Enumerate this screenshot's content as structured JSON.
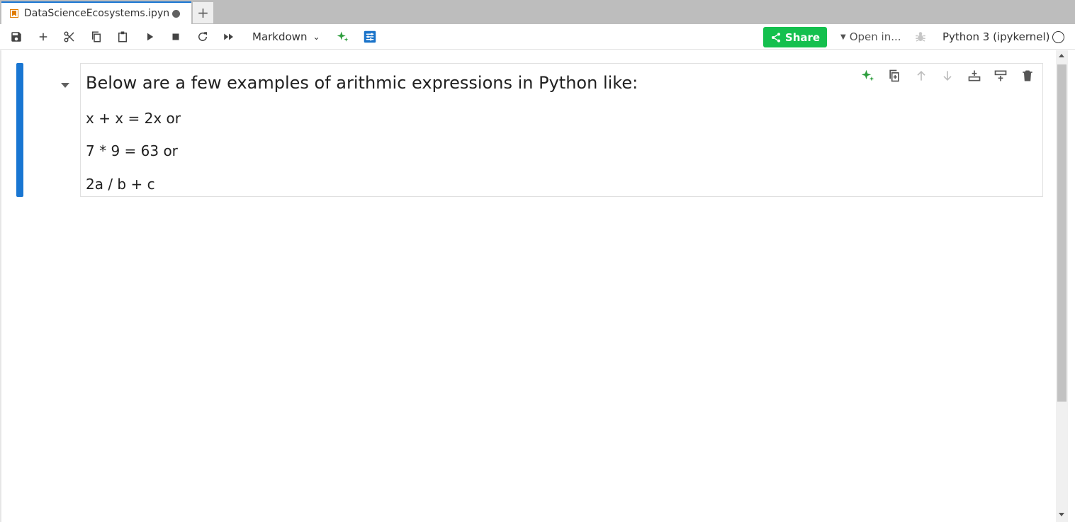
{
  "tab": {
    "title": "DataScienceEcosystems.ipynb",
    "new_tab_label": "+"
  },
  "toolbar": {
    "cell_type": "Markdown",
    "share_label": "Share",
    "open_in_label": "Open in...",
    "kernel_name": "Python 3 (ipykernel)"
  },
  "cell": {
    "heading": "Below are a few examples of arithmic expressions in Python like:",
    "lines": [
      "x + x = 2x or",
      "7 * 9 = 63 or",
      "2a / b + c"
    ]
  },
  "colors": {
    "accent": "#1976d2",
    "share": "#14c04e",
    "ai_green": "#2e9e3e"
  }
}
